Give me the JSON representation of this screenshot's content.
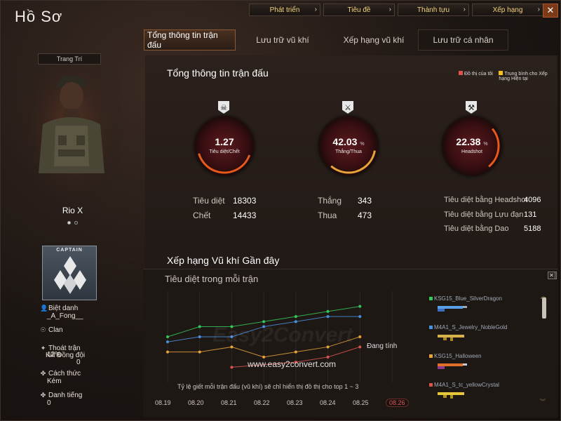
{
  "window": {
    "title": "Hồ Sơ"
  },
  "top_menu": [
    {
      "label": "Phát triển"
    },
    {
      "label": "Tiêu đề"
    },
    {
      "label": "Thành tựu"
    },
    {
      "label": "Xếp hạng"
    }
  ],
  "tabs": [
    {
      "label": "Tổng thông tin trận đấu",
      "active": true
    },
    {
      "label": "Lưu trữ vũ khí"
    },
    {
      "label": "Xếp hạng vũ khí"
    },
    {
      "label": "Lưu trữ cá nhân"
    }
  ],
  "left": {
    "decoration_label": "Trang Trí",
    "character_name": "Rio X",
    "rank_badge": "CAPTAIN",
    "nickname_label": "Biệt danh",
    "nickname_value": "_A_Fong__",
    "clan_label": "Clan",
    "escape_label": "Thoát trận",
    "escape_value": "12%",
    "teamkill_label": "Kill Đồng đội",
    "teamkill_value": "0",
    "method_label": "Cách thức",
    "method_value": "Kém",
    "reputation_label": "Danh tiếng",
    "reputation_value": "0"
  },
  "summary": {
    "title": "Tổng thông tin trận đấu",
    "legend_mine": "Đồ thị của tôi",
    "legend_avg": "Trung bình cho Xếp hạng Hiện tại",
    "kd": {
      "value": "1.27",
      "label": "Tiêu diệt/Chết"
    },
    "winrate": {
      "value": "42.03",
      "unit": "%",
      "label": "Thắng/Thua"
    },
    "headshot": {
      "value": "22.38",
      "unit": "%",
      "label": "Headshot"
    },
    "kills_label": "Tiêu diệt",
    "kills": "18303",
    "deaths_label": "Chết",
    "deaths": "14433",
    "wins_label": "Thắng",
    "wins": "343",
    "losses_label": "Thua",
    "losses": "473",
    "hs_kills_label": "Tiêu diệt bằng Headshot",
    "hs_kills": "4096",
    "grenade_kills_label": "Tiêu diệt bằng Lựu đạn",
    "grenade_kills": "131",
    "knife_kills_label": "Tiêu diệt bằng Dao",
    "knife_kills": "5188"
  },
  "recent": {
    "title": "Xếp hạng Vũ khí Gần đây",
    "subtitle": "Tiêu diệt trong mỗi trận",
    "status": "Đang tính",
    "note": "Tỷ lệ giết mỗi trận đấu (vũ khí) sẽ chỉ hiển thị đồ thị cho top 1 ~ 3",
    "watermark": "Easy2Convert",
    "watermark_url": "www.easy2convert.com",
    "weapons": [
      {
        "name": "KSG15_Blue_SilverDragon",
        "color": "#34c759"
      },
      {
        "name": "M4A1_S_Jewelry_NobleGold",
        "color": "#4a90e2"
      },
      {
        "name": "KSG15_Halloween",
        "color": "#e8a33a"
      },
      {
        "name": "M4A1_S_tc_yellowCrystal",
        "color": "#d9534f"
      }
    ],
    "dates": [
      "08.19",
      "08.20",
      "08.21",
      "08.22",
      "08.23",
      "08.24",
      "08.25",
      "08.26"
    ],
    "active_date": "08.26"
  },
  "chart_data": {
    "type": "line",
    "title": "Tiêu diệt trong mỗi trận",
    "categories": [
      "08.19",
      "08.20",
      "08.21",
      "08.22",
      "08.23",
      "08.24",
      "08.25",
      "08.26"
    ],
    "series": [
      {
        "name": "KSG15_Blue_SilverDragon",
        "color": "#34c759",
        "values": [
          17,
          19,
          19,
          20,
          21,
          22,
          23,
          null
        ]
      },
      {
        "name": "M4A1_S_Jewelry_NobleGold",
        "color": "#4a90e2",
        "values": [
          16,
          17,
          17,
          19,
          20,
          21,
          21,
          null
        ]
      },
      {
        "name": "KSG15_Halloween",
        "color": "#e8a33a",
        "values": [
          14,
          14,
          15,
          13,
          14,
          15,
          17,
          null
        ]
      },
      {
        "name": "M4A1_S_tc_yellowCrystal",
        "color": "#d9534f",
        "values": [
          null,
          null,
          11,
          null,
          12,
          13,
          15,
          null
        ]
      }
    ],
    "ylim": [
      8,
      26
    ]
  }
}
